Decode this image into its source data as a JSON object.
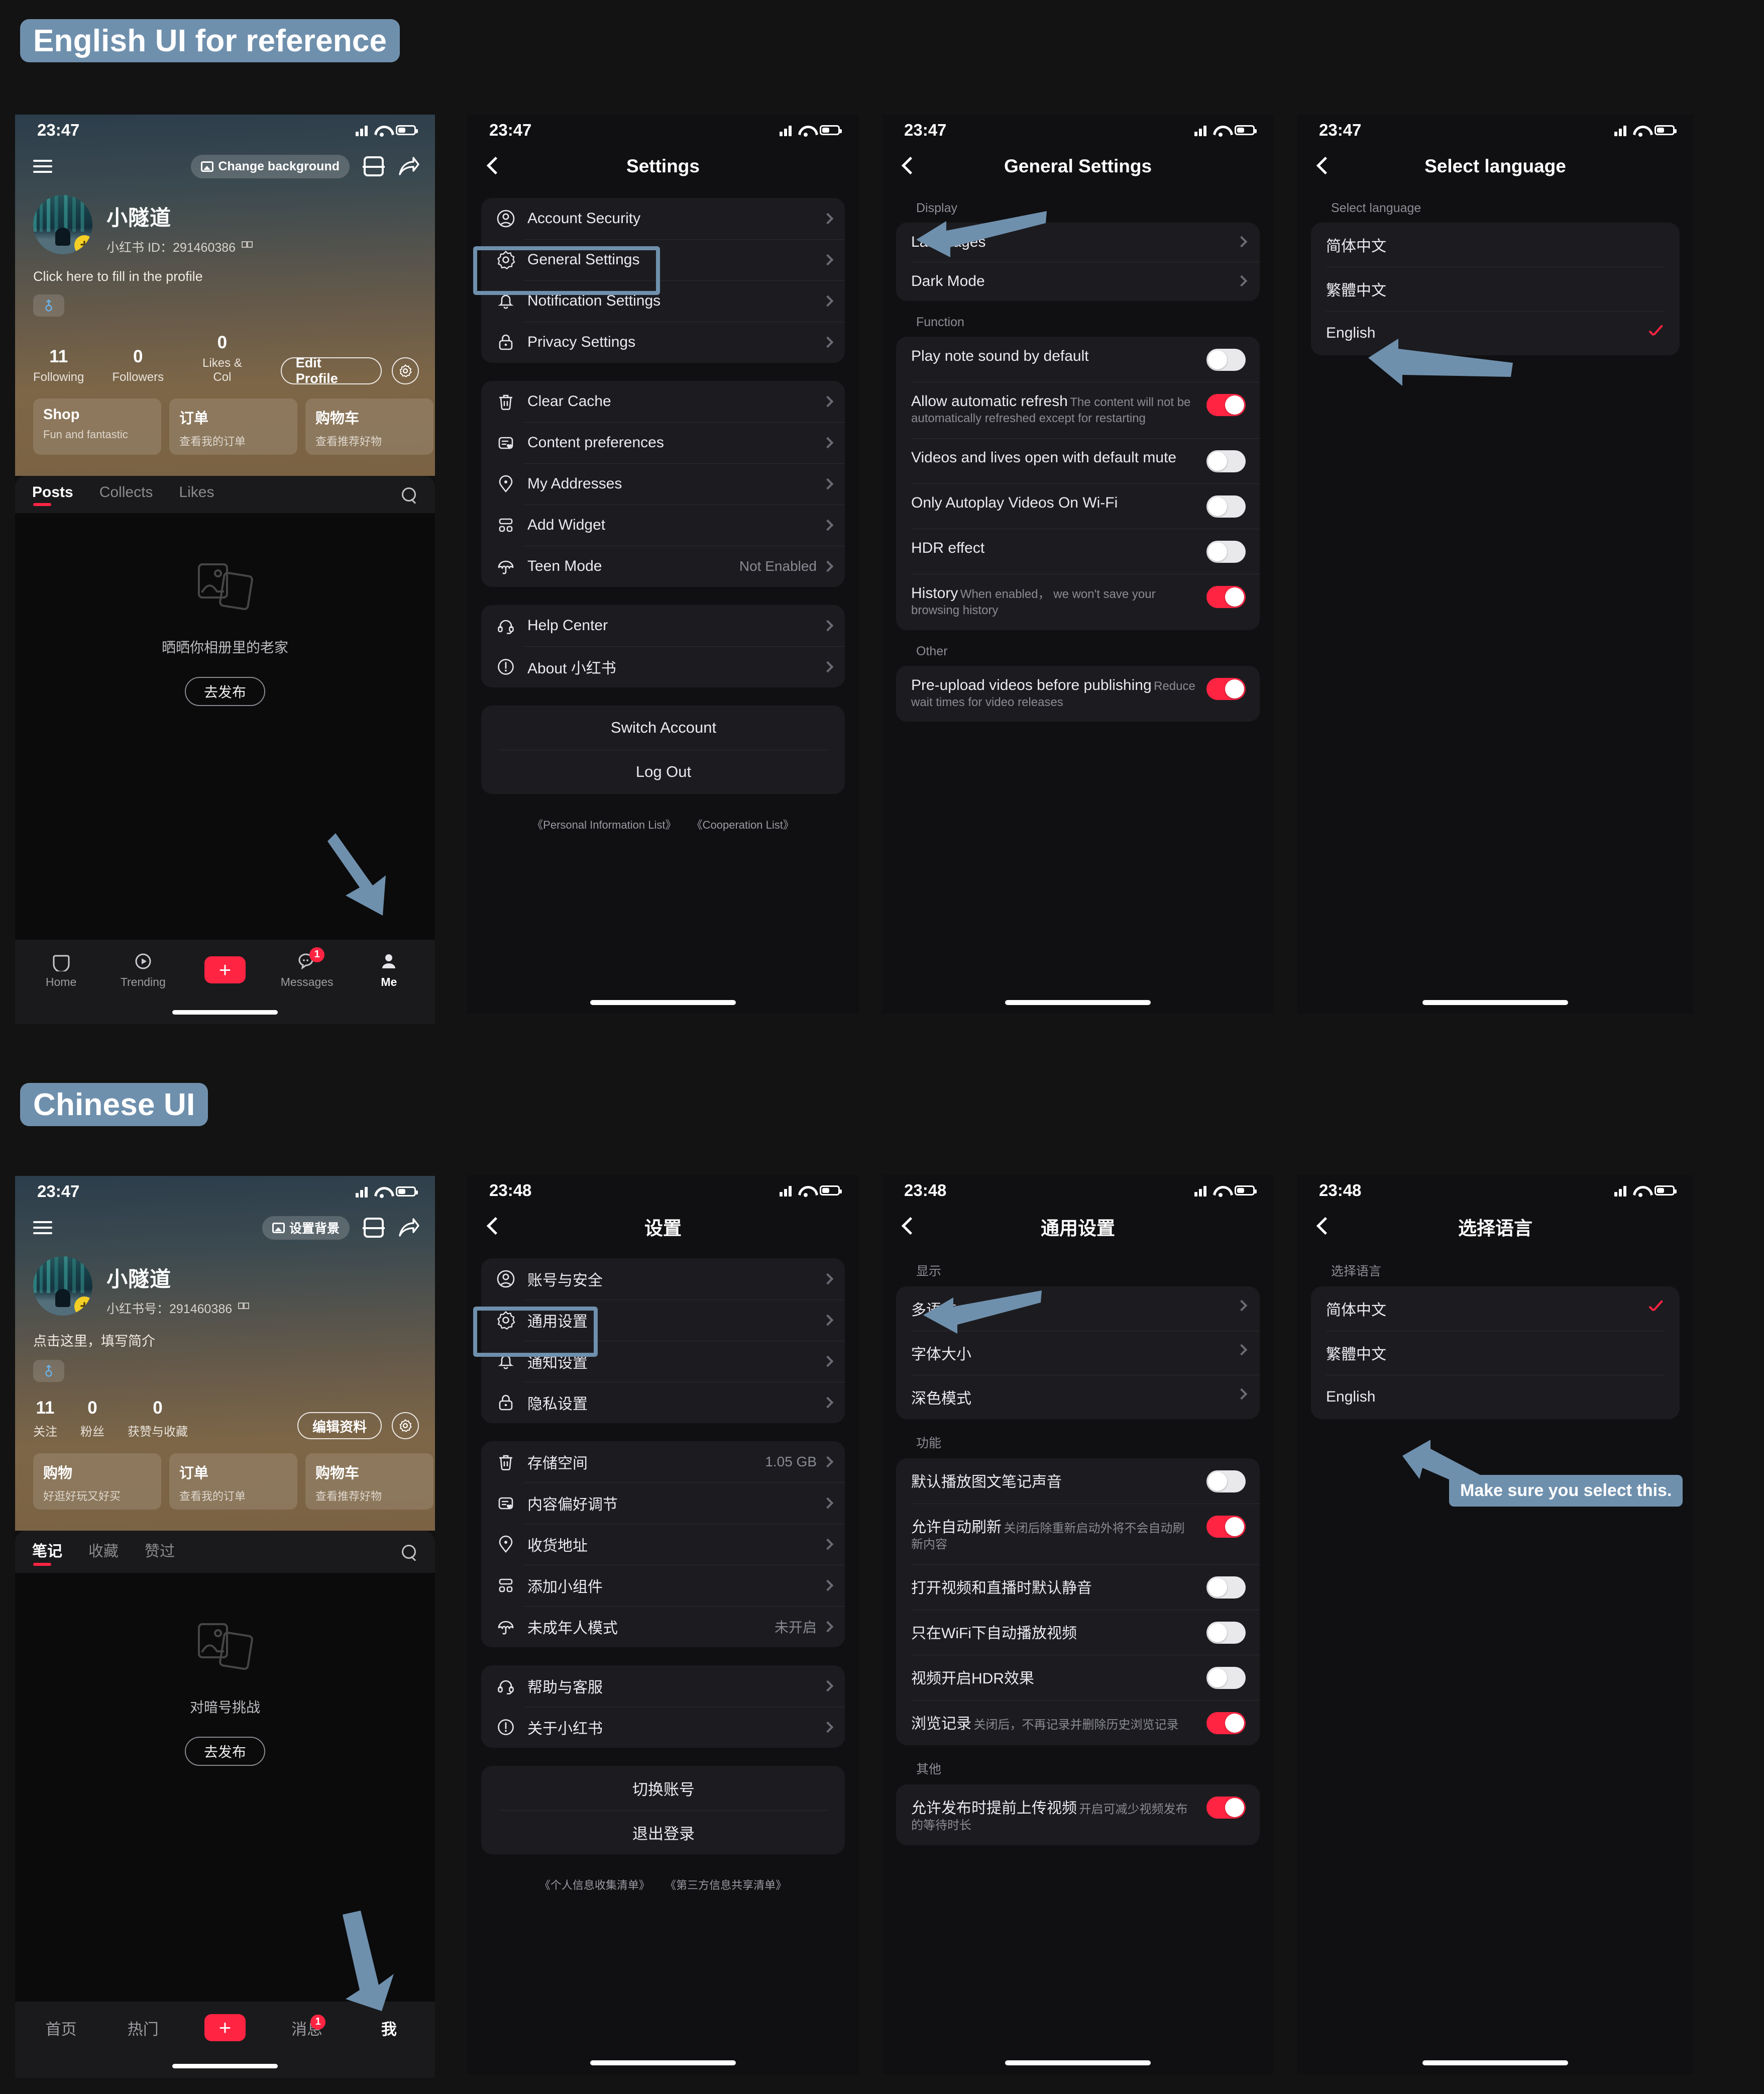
{
  "sections": {
    "english_badge": "English UI for reference",
    "chinese_badge": "Chinese UI"
  },
  "callout": "Make sure you select this.",
  "colors": {
    "accent_red": "#ff2442",
    "annotation_blue": "#6f90ad",
    "panel": "#1c1c20",
    "background": "#131313"
  },
  "en": {
    "profile": {
      "status_time": "23:47",
      "change_background": "Change background",
      "nickname": "小隧道",
      "id_line": "小红书 ID：291460386",
      "bio": "Click here to fill in the profile",
      "stats": [
        {
          "value": "11",
          "label": "Following"
        },
        {
          "value": "0",
          "label": "Followers"
        },
        {
          "value": "0",
          "label": "Likes & Col"
        }
      ],
      "edit_profile": "Edit Profile",
      "cards": [
        {
          "title": "Shop",
          "subtitle": "Fun and fantastic"
        },
        {
          "title": "订单",
          "subtitle": "查看我的订单"
        },
        {
          "title": "购物车",
          "subtitle": "查看推荐好物"
        }
      ],
      "tabs": [
        {
          "label": "Posts",
          "active": true
        },
        {
          "label": "Collects",
          "active": false
        },
        {
          "label": "Likes",
          "active": false
        }
      ],
      "empty_text": "晒晒你相册里的老家",
      "empty_button": "去发布",
      "bottom_nav": [
        {
          "label": "Home",
          "icon": "home-icon",
          "active": false
        },
        {
          "label": "Trending",
          "icon": "play-circle-icon",
          "active": false
        },
        {
          "label": "",
          "icon": "plus-icon",
          "active": false
        },
        {
          "label": "Messages",
          "icon": "chat-icon",
          "active": false,
          "badge": "1"
        },
        {
          "label": "Me",
          "icon": "person-icon",
          "active": true
        }
      ]
    },
    "settings": {
      "status_time": "23:47",
      "title": "Settings",
      "group1": [
        {
          "label": "Account Security",
          "icon": "person-circle-icon",
          "value": ""
        },
        {
          "label": "General Settings",
          "icon": "gear-icon",
          "value": "",
          "highlighted": true
        },
        {
          "label": "Notification Settings",
          "icon": "bell-icon",
          "value": ""
        },
        {
          "label": "Privacy Settings",
          "icon": "lock-icon",
          "value": ""
        }
      ],
      "group2": [
        {
          "label": "Clear Cache",
          "icon": "trash-icon",
          "value": ""
        },
        {
          "label": "Content preferences",
          "icon": "content-heart-icon",
          "value": ""
        },
        {
          "label": "My Addresses",
          "icon": "pin-icon",
          "value": ""
        },
        {
          "label": "Add Widget",
          "icon": "widget-icon",
          "value": ""
        },
        {
          "label": "Teen Mode",
          "icon": "umbrella-icon",
          "value": "Not Enabled"
        }
      ],
      "group3": [
        {
          "label": "Help Center",
          "icon": "headset-icon",
          "value": ""
        },
        {
          "label": "About 小红书",
          "icon": "info-icon",
          "value": ""
        }
      ],
      "actions": [
        "Switch Account",
        "Log Out"
      ],
      "legal": [
        "《Personal Information List》",
        "《Cooperation List》"
      ]
    },
    "general": {
      "status_time": "23:47",
      "title": "General Settings",
      "display_label": "Display",
      "display_rows": [
        {
          "label": "Languages"
        },
        {
          "label": "Dark Mode"
        }
      ],
      "function_label": "Function",
      "function_rows": [
        {
          "label": "Play note sound by default",
          "desc": "",
          "on": false
        },
        {
          "label": "Allow automatic refresh",
          "desc": "The content will not be automatically refreshed except for restarting",
          "on": true
        },
        {
          "label": "Videos and lives open with default mute",
          "desc": "",
          "on": false
        },
        {
          "label": "Only Autoplay Videos On Wi-Fi",
          "desc": "",
          "on": false
        },
        {
          "label": "HDR effect",
          "desc": "",
          "on": false
        },
        {
          "label": "History",
          "desc": "When enabled， we won't save your browsing history",
          "on": true
        }
      ],
      "other_label": "Other",
      "other_rows": [
        {
          "label": "Pre-upload videos before publishing",
          "desc": "Reduce wait times for video releases",
          "on": true
        }
      ]
    },
    "language": {
      "status_time": "23:47",
      "title": "Select language",
      "section_label": "Select language",
      "options": [
        {
          "label": "简体中文",
          "selected": false
        },
        {
          "label": "繁體中文",
          "selected": false
        },
        {
          "label": "English",
          "selected": true
        }
      ]
    }
  },
  "zh": {
    "profile": {
      "status_time": "23:47",
      "change_background": "设置背景",
      "nickname": "小隧道",
      "id_line": "小红书号：291460386",
      "bio": "点击这里，填写简介",
      "stats": [
        {
          "value": "11",
          "label": "关注"
        },
        {
          "value": "0",
          "label": "粉丝"
        },
        {
          "value": "0",
          "label": "获赞与收藏"
        }
      ],
      "edit_profile": "编辑资料",
      "cards": [
        {
          "title": "购物",
          "subtitle": "好逛好玩又好买"
        },
        {
          "title": "订单",
          "subtitle": "查看我的订单"
        },
        {
          "title": "购物车",
          "subtitle": "查看推荐好物"
        }
      ],
      "tabs": [
        {
          "label": "笔记",
          "active": true
        },
        {
          "label": "收藏",
          "active": false
        },
        {
          "label": "赞过",
          "active": false
        }
      ],
      "empty_text": "对暗号挑战",
      "empty_button": "去发布",
      "bottom_nav": [
        {
          "label": "首页",
          "icon": "",
          "active": false
        },
        {
          "label": "热门",
          "icon": "",
          "active": false
        },
        {
          "label": "",
          "icon": "plus-icon",
          "active": false
        },
        {
          "label": "消息",
          "icon": "",
          "active": false,
          "badge": "1"
        },
        {
          "label": "我",
          "icon": "",
          "active": true
        }
      ]
    },
    "settings": {
      "status_time": "23:48",
      "title": "设置",
      "group1": [
        {
          "label": "账号与安全",
          "icon": "person-circle-icon",
          "value": ""
        },
        {
          "label": "通用设置",
          "icon": "gear-icon",
          "value": "",
          "highlighted": true
        },
        {
          "label": "通知设置",
          "icon": "bell-icon",
          "value": ""
        },
        {
          "label": "隐私设置",
          "icon": "lock-icon",
          "value": ""
        }
      ],
      "group2": [
        {
          "label": "存储空间",
          "icon": "trash-icon",
          "value": "1.05 GB"
        },
        {
          "label": "内容偏好调节",
          "icon": "content-heart-icon",
          "value": ""
        },
        {
          "label": "收货地址",
          "icon": "pin-icon",
          "value": ""
        },
        {
          "label": "添加小组件",
          "icon": "widget-icon",
          "value": ""
        },
        {
          "label": "未成年人模式",
          "icon": "umbrella-icon",
          "value": "未开启"
        }
      ],
      "group3": [
        {
          "label": "帮助与客服",
          "icon": "headset-icon",
          "value": ""
        },
        {
          "label": "关于小红书",
          "icon": "info-icon",
          "value": ""
        }
      ],
      "actions": [
        "切换账号",
        "退出登录"
      ],
      "legal": [
        "《个人信息收集清单》",
        "《第三方信息共享清单》"
      ]
    },
    "general": {
      "status_time": "23:48",
      "title": "通用设置",
      "display_label": "显示",
      "display_rows": [
        {
          "label": "多语言"
        },
        {
          "label": "字体大小"
        },
        {
          "label": "深色模式"
        }
      ],
      "function_label": "功能",
      "function_rows": [
        {
          "label": "默认播放图文笔记声音",
          "desc": "",
          "on": false
        },
        {
          "label": "允许自动刷新",
          "desc": "关闭后除重新启动外将不会自动刷新内容",
          "on": true
        },
        {
          "label": "打开视频和直播时默认静音",
          "desc": "",
          "on": false
        },
        {
          "label": "只在WiFi下自动播放视频",
          "desc": "",
          "on": false
        },
        {
          "label": "视频开启HDR效果",
          "desc": "",
          "on": false
        },
        {
          "label": "浏览记录",
          "desc": "关闭后，不再记录并删除历史浏览记录",
          "on": true
        }
      ],
      "other_label": "其他",
      "other_rows": [
        {
          "label": "允许发布时提前上传视频",
          "desc": "开启可减少视频发布的等待时长",
          "on": true
        }
      ]
    },
    "language": {
      "status_time": "23:48",
      "title": "选择语言",
      "section_label": "选择语言",
      "options": [
        {
          "label": "简体中文",
          "selected": true
        },
        {
          "label": "繁體中文",
          "selected": false
        },
        {
          "label": "English",
          "selected": false
        }
      ]
    }
  }
}
